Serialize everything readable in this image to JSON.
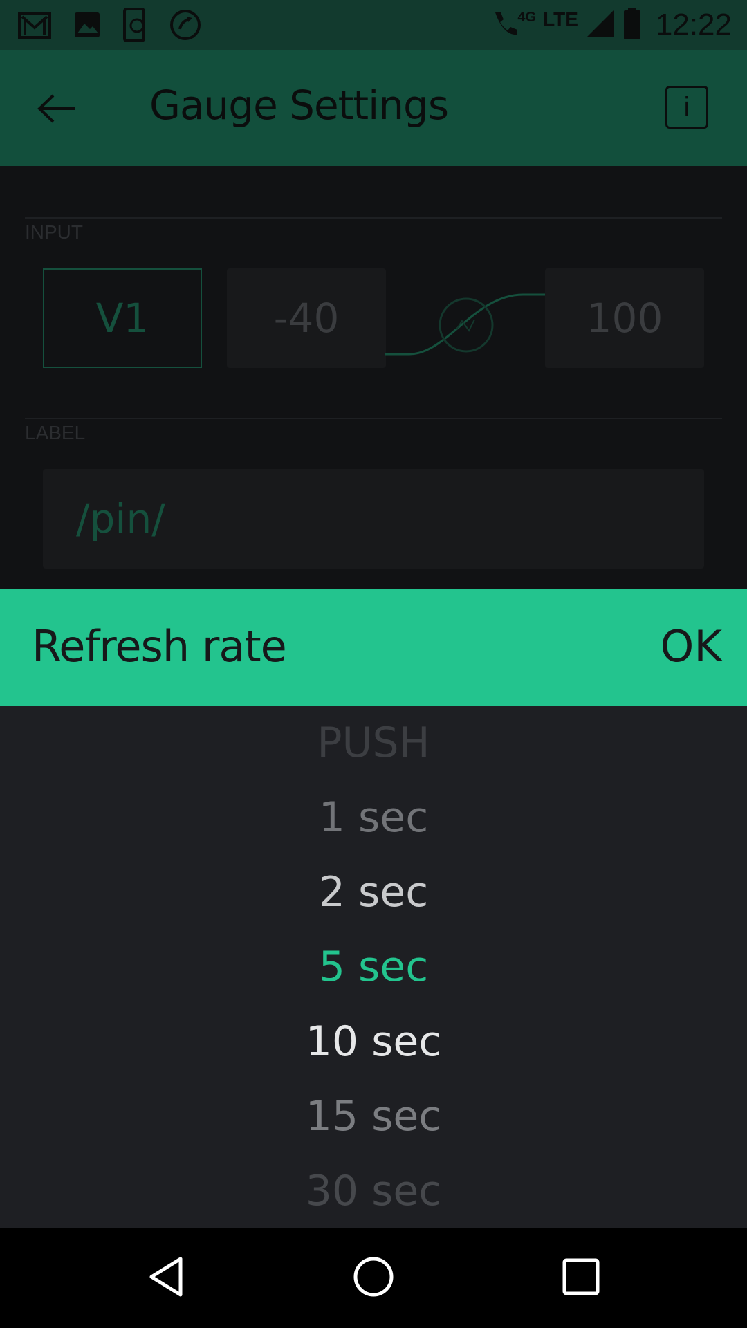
{
  "status_bar": {
    "network_small": "4G",
    "network": "LTE",
    "time": "12:22",
    "left_icons": [
      "gmail-icon",
      "gallery-icon",
      "phone-sync-icon",
      "call-forward-icon"
    ],
    "right_icons": [
      "wifi-call-icon",
      "signal-icon",
      "battery-icon"
    ]
  },
  "app_bar": {
    "title": "Gauge Settings",
    "back_icon": "arrow-left-icon",
    "info_label": "i"
  },
  "settings": {
    "input_label": "INPUT",
    "pin": "V1",
    "range_min": "-40",
    "range_max": "100",
    "label_section": "LABEL",
    "label_value": "/pin/"
  },
  "dialog": {
    "title": "Refresh rate",
    "ok_label": "OK",
    "selected_index": 3,
    "options": [
      {
        "label": "PUSH",
        "color": "#3c3e42"
      },
      {
        "label": "1 sec",
        "color": "#727478"
      },
      {
        "label": "2 sec",
        "color": "#c9cacc"
      },
      {
        "label": "5 sec",
        "color": "#23c48e"
      },
      {
        "label": "10 sec",
        "color": "#e6e7e8"
      },
      {
        "label": "15 sec",
        "color": "#7b7d81"
      },
      {
        "label": "30 sec",
        "color": "#46484c"
      }
    ]
  },
  "colors": {
    "accent": "#23c48e",
    "app_bar": "#124f3c",
    "status_bar": "#123a2e",
    "background": "#1e1f23"
  },
  "nav_bar": {
    "icons": [
      "back-triangle-icon",
      "home-circle-icon",
      "recents-square-icon"
    ]
  }
}
